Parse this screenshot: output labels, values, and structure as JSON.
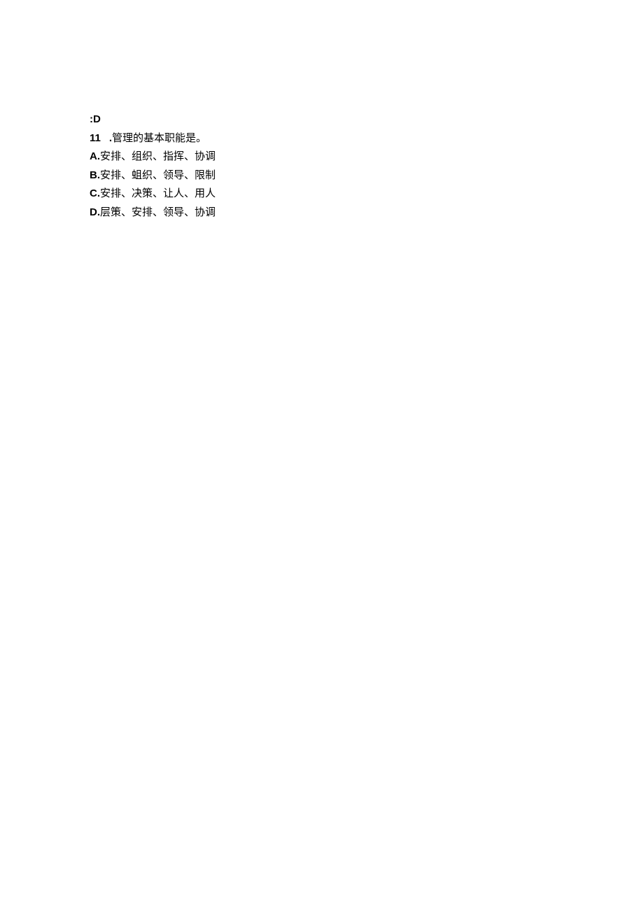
{
  "answer_line": {
    "prefix": ":D"
  },
  "question": {
    "number": "11",
    "separator": ".",
    "text": "管理的基本职能是。"
  },
  "options": {
    "A": {
      "prefix": "A.",
      "text": "安排、组织、指挥、协调"
    },
    "B": {
      "prefix": "B.",
      "text": "安排、蛆织、领导、限制"
    },
    "C": {
      "prefix": "C.",
      "text": "安排、决策、让人、用人"
    },
    "D": {
      "prefix": "D.",
      "text": "层策、安排、领导、协调"
    }
  }
}
